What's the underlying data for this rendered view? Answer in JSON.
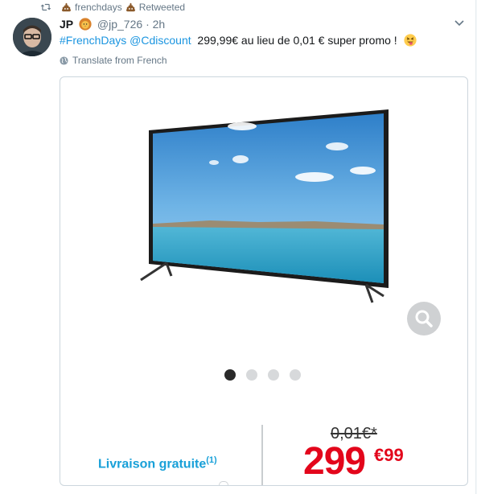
{
  "retweet": {
    "name": "frenchdays",
    "suffix": "Retweeted"
  },
  "tweet": {
    "author_name": "JP",
    "handle": "@jp_726",
    "separator": "·",
    "time": "2h",
    "hashtag": "#FrenchDays",
    "mention": "@Cdiscount",
    "body": "299,99€ au lieu de 0,01 € super promo !",
    "translate_label": "Translate from French"
  },
  "media": {
    "livraison": "Livraison gratuite",
    "livraison_note": "(1)",
    "old_price": "0,01€*",
    "new_price": "299",
    "new_cents": "€99",
    "carousel_total": 4,
    "carousel_active": 1
  }
}
